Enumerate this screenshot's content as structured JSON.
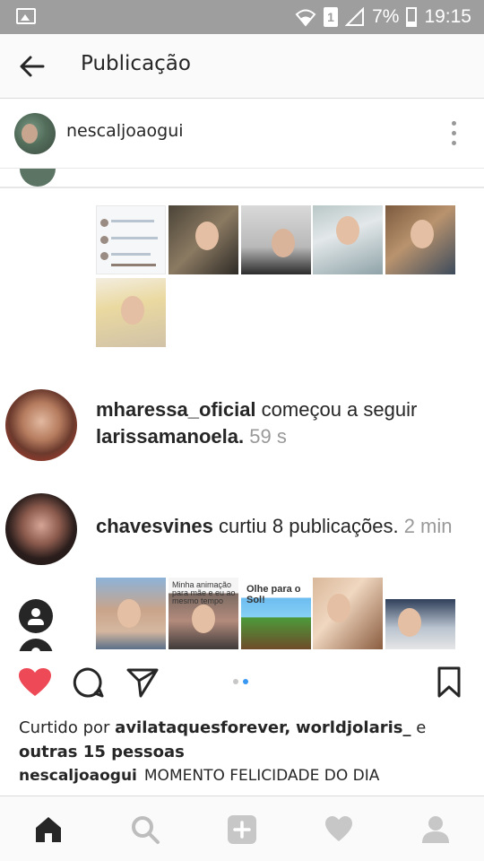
{
  "status_bar": {
    "battery_percent": "7%",
    "time": "19:15",
    "sim_label": "1"
  },
  "header": {
    "title": "Publicação"
  },
  "post": {
    "username": "nescaljoaogui",
    "image": {
      "notifications": [
        {
          "username": "mharessa_oficial",
          "text": "começou a seguir",
          "target": "larissamanoela.",
          "time": "59 s"
        },
        {
          "username": "chavesvines",
          "text": "curtiu 8 publicações.",
          "time": "2 min"
        }
      ],
      "thumb_captions": {
        "comic": "Olhe para o Sol!",
        "lower_left": "Minha animação para mãe e eu ao mesmo tempo"
      }
    },
    "carousel": {
      "count": 2,
      "active_index": 1
    },
    "likes": {
      "prefix": "Curtido por",
      "user1": "avilataquesforever,",
      "user2": "worldjolaris_",
      "connector": "e",
      "others": "outras 15 pessoas"
    },
    "caption": {
      "username": "nescaljoaogui",
      "text": "MOMENTO FELICIDADE DO DIA"
    },
    "caption_more": "..........",
    "liked": true
  },
  "colors": {
    "like_red": "#ed4956",
    "accent_blue": "#3897f0",
    "status_bar_gray": "#9e9e9e"
  },
  "bottom_nav": {
    "items": [
      "home-icon",
      "search-icon",
      "add-post-icon",
      "activity-heart-icon",
      "profile-icon"
    ]
  }
}
